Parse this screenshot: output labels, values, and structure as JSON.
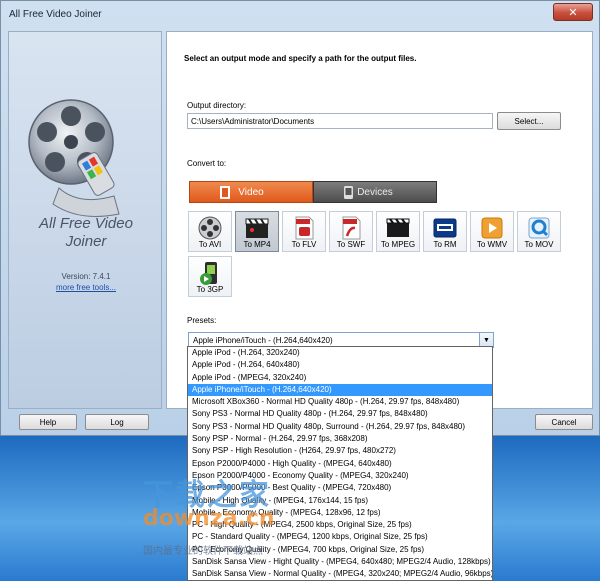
{
  "window": {
    "title": "All Free Video Joiner",
    "close_label": "✕"
  },
  "left": {
    "app_name_line1": "All Free Video",
    "app_name_line2": "Joiner",
    "version": "Version: 7.4.1",
    "more_link": "more free tools..."
  },
  "main": {
    "headline": "Select an output mode and specify a path for the output files.",
    "output_dir_label": "Output directory:",
    "output_dir_value": "C:\\Users\\Administrator\\Documents",
    "select_button": "Select...",
    "convert_label": "Convert to:",
    "tabs": [
      {
        "label": "Video",
        "icon": "film-icon",
        "active": true
      },
      {
        "label": "Devices",
        "icon": "phone-icon",
        "active": false
      }
    ],
    "formats": [
      {
        "label": "To AVI",
        "icon": "film-reel-icon",
        "selected": false
      },
      {
        "label": "To MP4",
        "icon": "clapperboard-icon",
        "selected": true
      },
      {
        "label": "To FLV",
        "icon": "flv-file-icon",
        "selected": false
      },
      {
        "label": "To SWF",
        "icon": "swf-file-icon",
        "selected": false
      },
      {
        "label": "To MPEG",
        "icon": "film-strip-icon",
        "selected": false
      },
      {
        "label": "To RM",
        "icon": "real-media-icon",
        "selected": false
      },
      {
        "label": "To WMV",
        "icon": "wmv-play-icon",
        "selected": false
      },
      {
        "label": "To MOV",
        "icon": "quicktime-icon",
        "selected": false
      },
      {
        "label": "To 3GP",
        "icon": "3gp-phone-icon",
        "selected": false
      }
    ],
    "presets_label": "Presets:",
    "preset_selected": "Apple iPhone/iTouch - (H.264,640x420)"
  },
  "bottom_buttons": {
    "help": "Help",
    "log": "Log",
    "cancel": "Cancel"
  },
  "presets_list": [
    "Apple iPod - (H.264, 320x240)",
    "Apple iPod - (H.264, 640x480)",
    "Apple iPod - (MPEG4, 320x240)",
    "Apple iPhone/iTouch - (H.264,640x420)",
    "Microsoft XBox360 - Normal HD Quality 480p - (H.264, 29.97 fps, 848x480)",
    "Sony PS3 - Normal HD Quality 480p - (H.264, 29.97 fps, 848x480)",
    "Sony PS3 - Normal HD Quality 480p, Surround - (H.264, 29.97 fps, 848x480)",
    "Sony PSP - Normal - (H.264, 29.97 fps, 368x208)",
    "Sony PSP - High Resolution - (H264, 29.97 fps, 480x272)",
    "Epson P2000/P4000 - High Quality - (MPEG4, 640x480)",
    "Epson P2000/P4000 - Economy Quality - (MPEG4, 320x240)",
    "Epson P3000/P5000 - Best Quality - (MPEG4, 720x480)",
    "Mobile - High Quality - (MPEG4, 176x144, 15 fps)",
    "Mobile - Economy Quality - (MPEG4, 128x96, 12 fps)",
    "PC - High Quality - (MPEG4, 2500 kbps, Original Size, 25 fps)",
    "PC - Standard Quality - (MPEG4, 1200 kbps, Original Size, 25 fps)",
    "PC - Economy Quality - (MPEG4, 700 kbps, Original Size, 25 fps)",
    "SanDisk Sansa View - Hight Quality - (MPEG4, 640x480; MPEG2/4 Audio, 128kbps)",
    "SanDisk Sansa View - Normal Quality - (MPEG4, 320x240; MPEG2/4 Audio, 96kbps)"
  ],
  "highlighted_preset_index": 3,
  "watermark": {
    "cn": "下载之家",
    "en": "downza.cn",
    "sub": "国内最专业的软件下载站点"
  },
  "colors": {
    "accent_orange": "#e0591c",
    "highlight_blue": "#3399ff",
    "link_blue": "#1f4fa3"
  }
}
